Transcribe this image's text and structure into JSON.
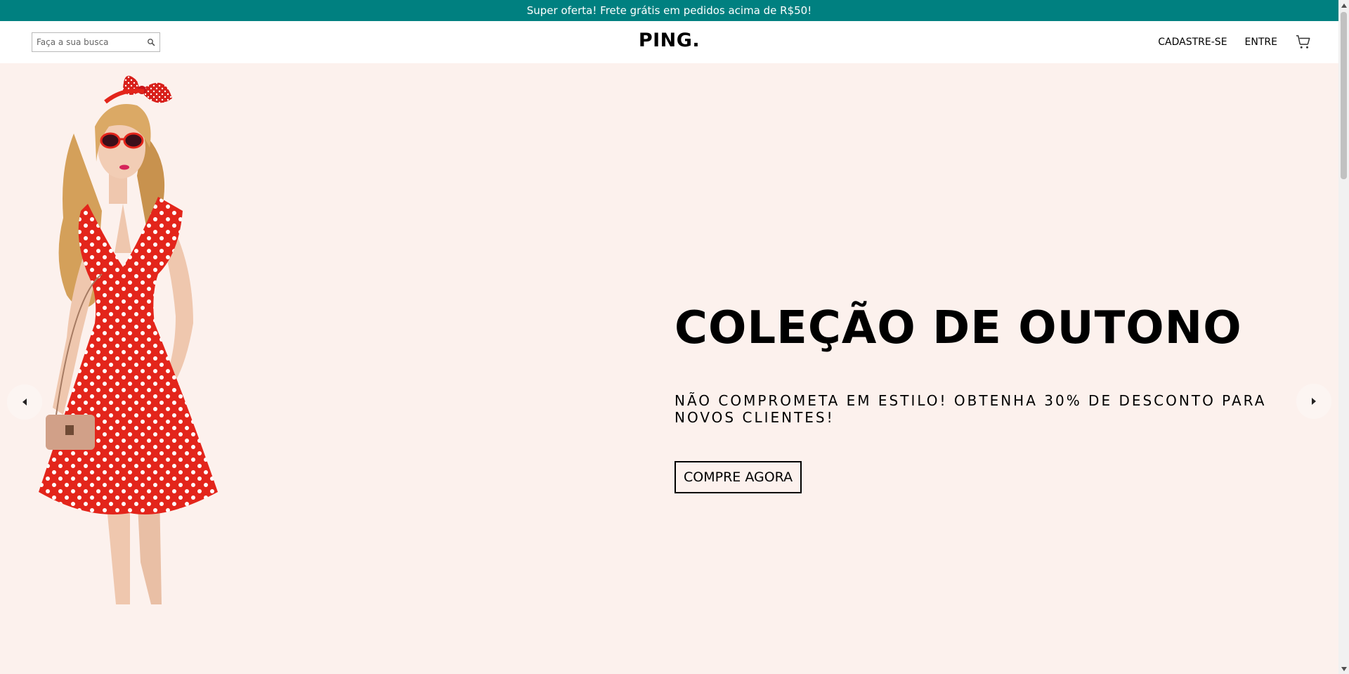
{
  "announcement": {
    "text": "Super oferta! Frete grátis em pedidos acima de R$50!"
  },
  "header": {
    "search": {
      "placeholder": "Faça a sua busca",
      "value": "",
      "icon": "search-icon"
    },
    "logo": "PING.",
    "links": {
      "register": "CADASTRE-SE",
      "login": "ENTRE"
    },
    "cart_icon": "shopping-cart-icon"
  },
  "slider": {
    "title": "COLEÇÃO DE OUTONO",
    "description": "NÃO COMPROMETA EM ESTILO! OBTENHA 30% DE DESCONTO PARA NOVOS CLIENTES!",
    "button": "COMPRE AGORA",
    "prev_icon": "arrow-left-icon",
    "next_icon": "arrow-right-icon",
    "image": "woman-red-polka-dot-dress"
  },
  "colors": {
    "announcement_bg": "#008080",
    "hero_bg": "#fcf1ed",
    "dress_red": "#e3251b"
  }
}
